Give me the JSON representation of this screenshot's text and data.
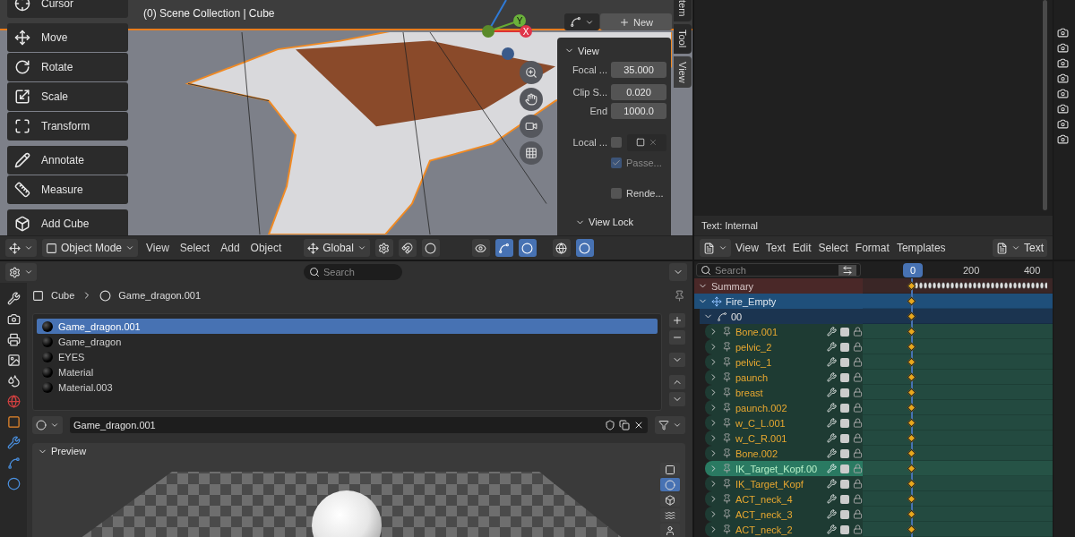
{
  "viewport": {
    "collection_label": "(0) Scene Collection | Cube",
    "tool_groups": [
      {
        "tools": [
          {
            "label": "Cursor",
            "kind": "cursor"
          }
        ]
      },
      {
        "tools": [
          {
            "label": "Move",
            "kind": "move"
          },
          {
            "label": "Rotate",
            "kind": "rotate"
          },
          {
            "label": "Scale",
            "kind": "scale"
          },
          {
            "label": "Transform",
            "kind": "transform"
          }
        ]
      },
      {
        "tools": [
          {
            "label": "Annotate",
            "kind": "annotate"
          },
          {
            "label": "Measure",
            "kind": "measure"
          }
        ]
      },
      {
        "tools": [
          {
            "label": "Add Cube",
            "kind": "cube"
          }
        ]
      }
    ],
    "gizmo": {
      "y_label": "Y",
      "x_label": "X"
    },
    "new_button": "New",
    "sidebar": {
      "title": "View",
      "fields": [
        {
          "label": "Focal ...",
          "value": "35.000"
        },
        {
          "label": "Clip S...",
          "value": "0.020"
        },
        {
          "label": "End",
          "value": "1000.0"
        }
      ],
      "local_label": "Local ...",
      "local_checked": false,
      "checks": [
        {
          "label": "Passe...",
          "checked": true,
          "disabled": true
        },
        {
          "label": "Rende...",
          "checked": false,
          "disabled": false
        }
      ],
      "subpanel": "View Lock"
    },
    "sidebar_tabs": [
      {
        "label": "tem",
        "selected": false
      },
      {
        "label": "Tool",
        "selected": false
      },
      {
        "label": "View",
        "selected": true
      }
    ],
    "header": {
      "mode": "Object Mode",
      "menus": [
        "View",
        "Select",
        "Add",
        "Object"
      ],
      "orientation": "Global"
    }
  },
  "text_editor": {
    "status": "Text: Internal",
    "menus": [
      "View",
      "Text",
      "Edit",
      "Select",
      "Format",
      "Templates"
    ],
    "datablock": "Text"
  },
  "properties": {
    "search": {
      "placeholder": "Search"
    },
    "breadcrumb": [
      "Cube",
      "Game_dragon.001"
    ],
    "slots": [
      {
        "name": "Game_dragon.001",
        "selected": true
      },
      {
        "name": "Game_dragon",
        "selected": false
      },
      {
        "name": "EYES",
        "selected": false
      },
      {
        "name": "Material",
        "selected": false
      },
      {
        "name": "Material.003",
        "selected": false
      }
    ],
    "material_name": "Game_dragon.001",
    "panel_title": "Preview",
    "preview_buttons": [
      {
        "kind": "plane",
        "selected": false
      },
      {
        "kind": "sphere",
        "selected": true
      },
      {
        "kind": "cube",
        "selected": false
      },
      {
        "kind": "hair",
        "selected": false
      },
      {
        "kind": "monkey",
        "selected": false
      }
    ]
  },
  "dopesheet": {
    "search": {
      "placeholder": "Search"
    },
    "current_frame": "0",
    "ticks": [
      "200",
      "400"
    ],
    "summary": "Summary",
    "object": "Fire_Empty",
    "action": "00",
    "channels": [
      {
        "name": "Bone.001",
        "selected": false
      },
      {
        "name": "pelvic_2",
        "selected": false
      },
      {
        "name": "pelvic_1",
        "selected": false
      },
      {
        "name": "paunch",
        "selected": false
      },
      {
        "name": "breast",
        "selected": false
      },
      {
        "name": "paunch.002",
        "selected": false
      },
      {
        "name": "w_C_L.001",
        "selected": false
      },
      {
        "name": "w_C_R.001",
        "selected": false
      },
      {
        "name": "Bone.002",
        "selected": false
      },
      {
        "name": "IK_Target_Kopf.00",
        "selected": true
      },
      {
        "name": "IK_Target_Kopf",
        "selected": false
      },
      {
        "name": "ACT_neck_4",
        "selected": false
      },
      {
        "name": "ACT_neck_3",
        "selected": false
      },
      {
        "name": "ACT_neck_2",
        "selected": false
      }
    ]
  }
}
